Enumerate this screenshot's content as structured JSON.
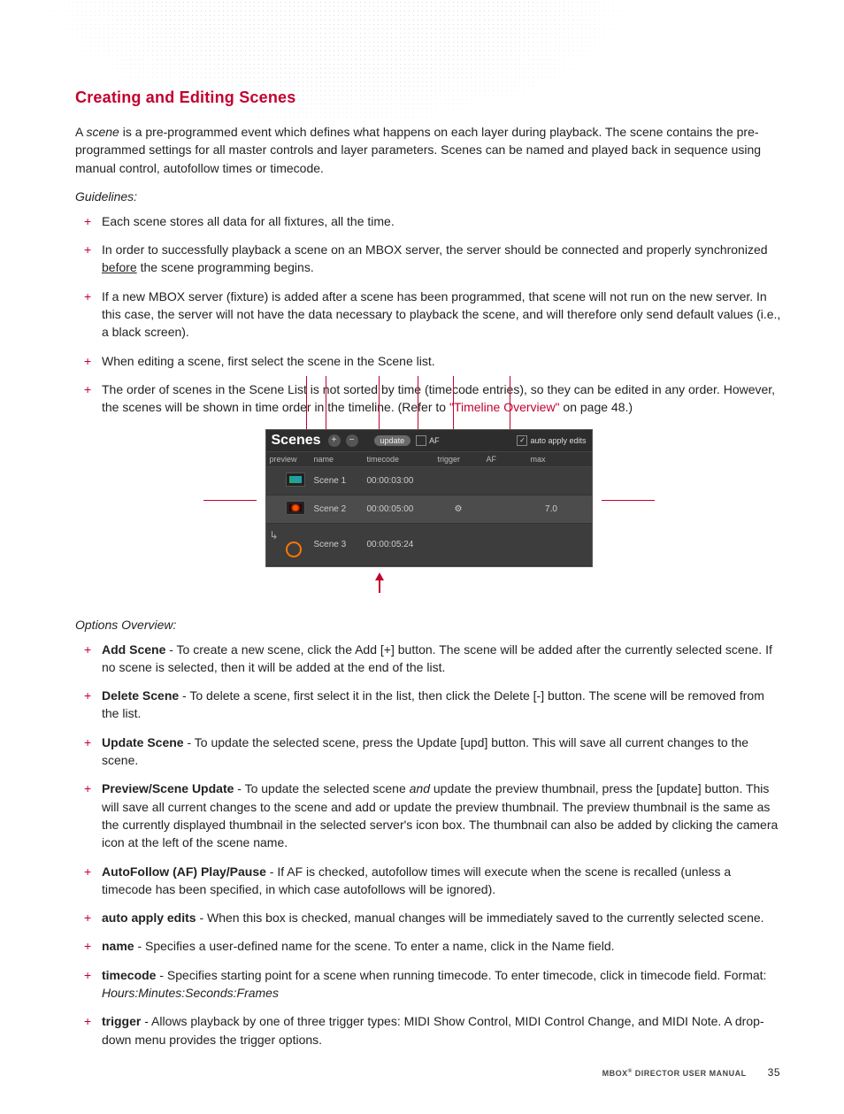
{
  "heading": "Creating and Editing Scenes",
  "intro_1a": "A ",
  "intro_scene_word": "scene",
  "intro_1b": " is a pre-programmed event which defines what happens on each layer during playback. The scene contains the pre-programmed settings for all master controls and layer parameters. Scenes can be named and played back in sequence using manual control, autofollow times or timecode.",
  "guidelines_label": "Guidelines:",
  "guidelines": [
    {
      "text_a": "Each scene stores all data for all fixtures, all the time."
    },
    {
      "text_a": "In order to successfully playback a scene on an MBOX server, the server should be connected and properly synchronized ",
      "underline": "before",
      "text_b": " the scene programming begins."
    },
    {
      "text_a": "If a new MBOX server (fixture) is added after a scene has been programmed, that scene will not run on the new server. In this case, the server will not have the data necessary to playback the scene, and will therefore only send default values (i.e., a black screen)."
    },
    {
      "text_a": "When editing a scene, first select the scene in the Scene list."
    },
    {
      "text_a": "The order of scenes in the Scene List is not sorted by time (timecode entries), so they can be edited in any order. However, the scenes will be shown in time order in the timeline. (Refer to ",
      "link": "\"Timeline Overview\"",
      "text_b": " on page 48.)"
    }
  ],
  "panel": {
    "title": "Scenes",
    "add_btn": "+",
    "del_btn": "−",
    "update_btn": "update",
    "af_label": "AF",
    "auto_apply_label": "auto apply edits",
    "cols": [
      "preview",
      "name",
      "timecode",
      "trigger",
      "AF",
      "max"
    ],
    "rows": [
      {
        "name": "Scene 1",
        "timecode": "00:00:03:00",
        "trigger": "",
        "af": "",
        "max": ""
      },
      {
        "name": "Scene 2",
        "timecode": "00:00:05:00",
        "trigger": "gear",
        "af": "",
        "max": "7.0",
        "selected": true
      },
      {
        "name": "Scene 3",
        "timecode": "00:00:05:24",
        "trigger": "",
        "af": "",
        "max": "",
        "arrow": true
      }
    ]
  },
  "options_label": "Options Overview:",
  "options": [
    {
      "b": "Add Scene",
      "t": " - To create a new scene, click the Add [+] button. The scene will be added after the currently selected scene. If no scene is selected, then it will be added at the end of the list."
    },
    {
      "b": "Delete Scene",
      "t": " - To delete a scene, first select it in the list, then click the Delete [-] button. The scene will be removed from the list."
    },
    {
      "b": "Update Scene",
      "t": " - To update the selected scene, press the Update [upd] button. This will save all current changes to the scene."
    },
    {
      "b": "Preview/Scene Update",
      "t1": " - To update the selected scene ",
      "it": "and",
      "t2": " update the preview thumbnail, press the [update] button. This will save all current changes to the scene and add or update the preview thumbnail. The preview thumbnail is the same as the currently displayed thumbnail in the selected server's icon box. The thumbnail can also be added by clicking the camera icon at the left of the scene name."
    },
    {
      "b": "AutoFollow (AF) Play/Pause",
      "t": " - If AF is checked, autofollow times will execute when the scene is recalled (unless a timecode has been specified, in which case autofollows will be ignored)."
    },
    {
      "b": "auto apply edits",
      "t": " - When this box is checked, manual changes will be immediately saved to the currently selected scene."
    },
    {
      "b": "name",
      "t": " - Specifies a user-defined name for the scene. To enter a name, click in the Name field."
    },
    {
      "b": "timecode",
      "t1": " - Specifies starting point for a scene when running timecode. To enter timecode, click in timecode field. Format: ",
      "it": "Hours:Minutes:Seconds:Frames"
    },
    {
      "b": "trigger",
      "t": " - Allows playback by one of three trigger types: MIDI Show Control, MIDI Control Change, and MIDI Note. A drop-down menu provides the trigger options."
    }
  ],
  "footer_manual": "MBOX",
  "footer_manual2": " DIRECTOR USER MANUAL",
  "page_number": "35"
}
